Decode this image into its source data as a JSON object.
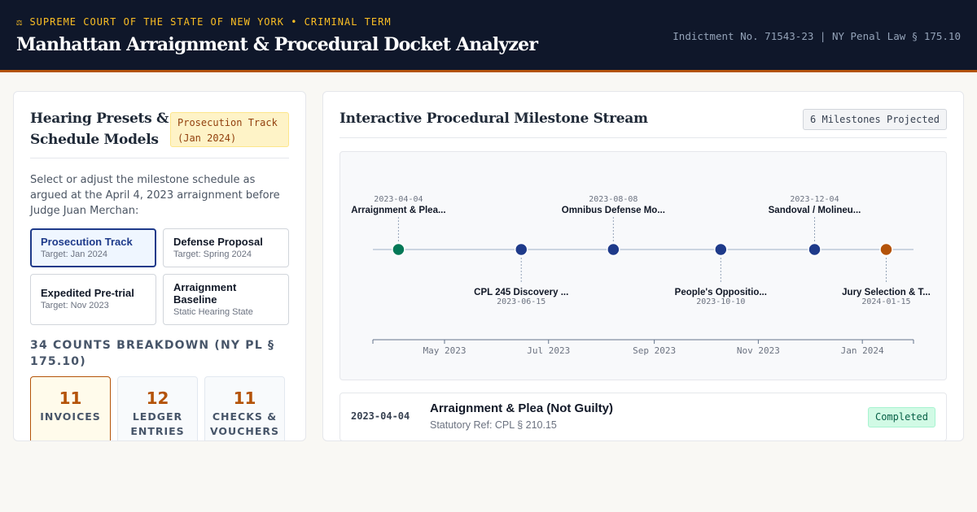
{
  "header": {
    "court_line": "⚖ SUPREME COURT OF THE STATE OF NEW YORK • CRIMINAL TERM",
    "title": "Manhattan Arraignment & Procedural Docket Analyzer",
    "indictment": "Indictment No. 71543-23 | NY Penal Law § 175.10",
    "accent_color": "#fbbf24",
    "bar_color": "#0f172a"
  },
  "left": {
    "title": "Hearing Presets & Schedule Models",
    "track_badge": "Prosecution Track (Jan 2024)",
    "description": "Select or adjust the milestone schedule as argued at the April 4, 2023 arraignment before Judge Juan Merchan:",
    "presets": [
      {
        "name": "Prosecution Track",
        "sub": "Target: Jan 2024",
        "active": true
      },
      {
        "name": "Defense Proposal",
        "sub": "Target: Spring 2024",
        "active": false
      },
      {
        "name": "Expedited Pre-trial",
        "sub": "Target: Nov 2023",
        "active": false
      },
      {
        "name": "Arraignment Baseline",
        "sub": "Static Hearing State",
        "active": false
      }
    ],
    "counts_heading": "34 COUNTS BREAKDOWN (NY PL § 175.10)",
    "counts": [
      {
        "value": "11",
        "label": "INVOICES"
      },
      {
        "value": "12",
        "label": "LEDGER ENTRIES"
      },
      {
        "value": "11",
        "label": "CHECKS & VOUCHERS"
      }
    ]
  },
  "right": {
    "title": "Interactive Procedural Milestone Stream",
    "milestones_badge": "6 Milestones Projected",
    "timeline": {
      "milestones": [
        {
          "date": "2023-04-04",
          "label": "Arraignment & Plea...",
          "position": "above",
          "color": "#047857"
        },
        {
          "date": "2023-06-15",
          "label": "CPL 245 Discovery ...",
          "position": "below",
          "color": "#1e3a8a"
        },
        {
          "date": "2023-08-08",
          "label": "Omnibus Defense Mo...",
          "position": "above",
          "color": "#1e3a8a"
        },
        {
          "date": "2023-10-10",
          "label": "People's Oppositio...",
          "position": "below",
          "color": "#1e3a8a"
        },
        {
          "date": "2023-12-04",
          "label": "Sandoval / Molineu...",
          "position": "above",
          "color": "#1e3a8a"
        },
        {
          "date": "2024-01-15",
          "label": "Jury Selection & T...",
          "position": "below",
          "color": "#b45309"
        }
      ],
      "axis_start": "2023-03-20",
      "axis_end": "2024-01-31",
      "axis_ticks": [
        {
          "label": "May 2023",
          "date": "2023-05-01"
        },
        {
          "label": "Jul 2023",
          "date": "2023-07-01"
        },
        {
          "label": "Sep 2023",
          "date": "2023-09-01"
        },
        {
          "label": "Nov 2023",
          "date": "2023-11-01"
        },
        {
          "label": "Jan 2024",
          "date": "2024-01-01"
        }
      ]
    },
    "rows": [
      {
        "date": "2023-04-04",
        "title": "Arraignment & Plea (Not Guilty)",
        "ref": "Statutory Ref: CPL § 210.15",
        "status": "Completed"
      }
    ]
  }
}
